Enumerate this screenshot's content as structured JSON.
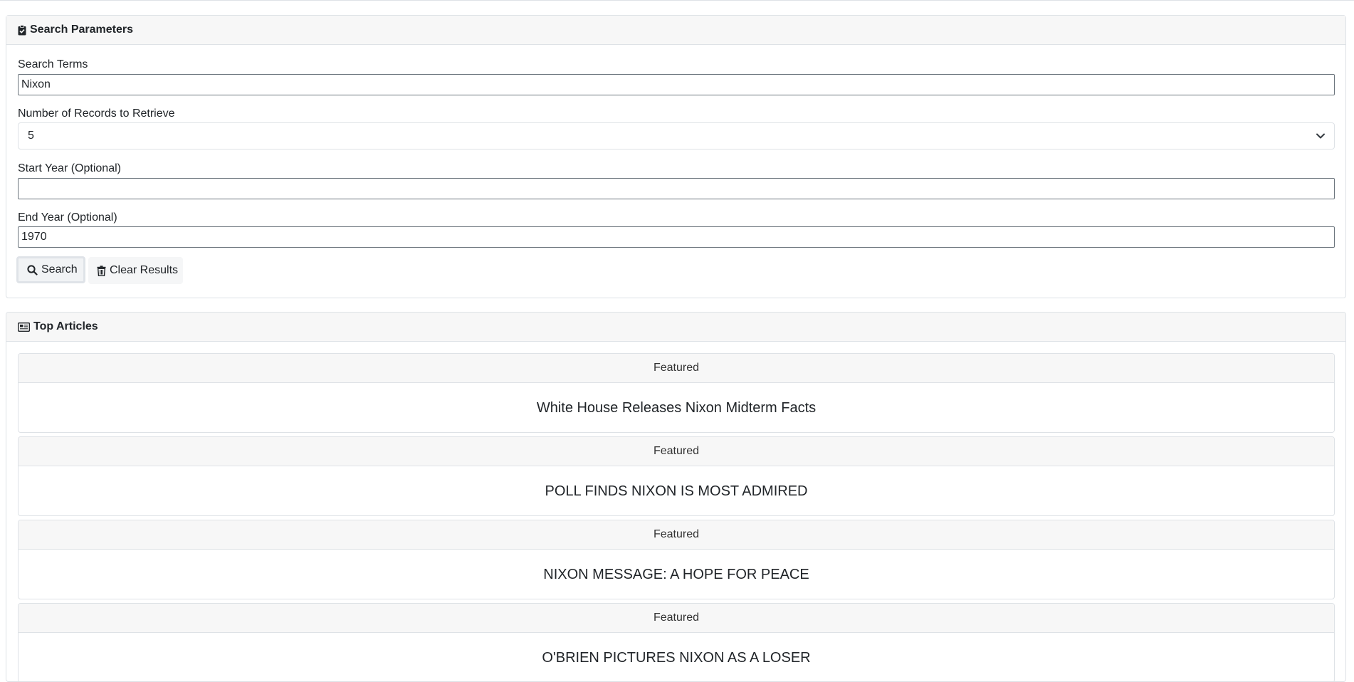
{
  "search_panel": {
    "title": "Search Parameters",
    "icon": "clipboard-check-icon",
    "fields": {
      "search_terms": {
        "label": "Search Terms",
        "value": "Nixon"
      },
      "num_records": {
        "label": "Number of Records to Retrieve",
        "value": "5"
      },
      "start_year": {
        "label": "Start Year (Optional)",
        "value": ""
      },
      "end_year": {
        "label": "End Year (Optional)",
        "value": "1970"
      }
    },
    "buttons": {
      "search": {
        "label": "Search",
        "icon": "search-icon"
      },
      "clear": {
        "label": "Clear Results",
        "icon": "trash-icon"
      }
    }
  },
  "articles_panel": {
    "title": "Top Articles",
    "icon": "newspaper-icon",
    "articles": [
      {
        "badge": "Featured",
        "title": "White House Releases Nixon Midterm Facts"
      },
      {
        "badge": "Featured",
        "title": "POLL FINDS NIXON IS MOST ADMIRED"
      },
      {
        "badge": "Featured",
        "title": "NIXON MESSAGE: A HOPE FOR PEACE"
      },
      {
        "badge": "Featured",
        "title": "O'BRIEN PICTURES NIXON AS A LOSER"
      }
    ]
  }
}
